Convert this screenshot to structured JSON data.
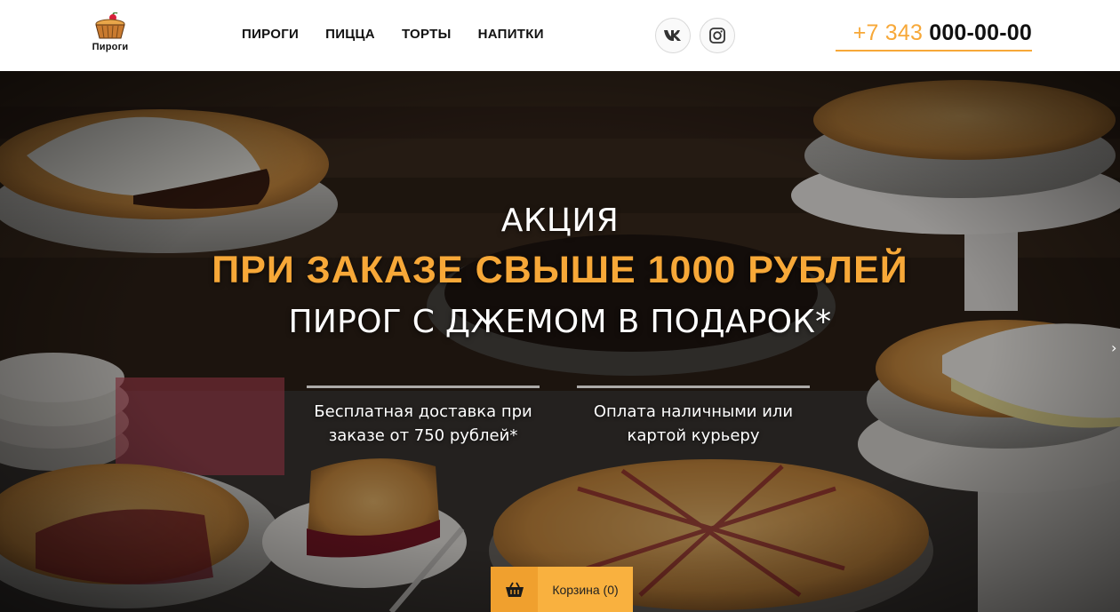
{
  "header": {
    "logo_text": "Пироги",
    "nav": [
      {
        "label": "ПИРОГИ"
      },
      {
        "label": "ПИЦЦА"
      },
      {
        "label": "ТОРТЫ"
      },
      {
        "label": "НАПИТКИ"
      }
    ],
    "social": [
      {
        "icon": "vk-icon"
      },
      {
        "icon": "instagram-icon"
      }
    ],
    "phone_code": "+7 343",
    "phone_number": "000-00-00"
  },
  "hero": {
    "title": "АКЦИЯ",
    "highlight": "ПРИ ЗАКАЗЕ СВЫШЕ 1000 РУБЛЕЙ",
    "subtitle": "ПИРОГ С ДЖЕМОМ В ПОДАРОК*",
    "features": [
      {
        "line1": "Бесплатная доставка при",
        "line2": "заказе от 750 рублей*"
      },
      {
        "line1": "Оплата наличными или",
        "line2": "картой курьеру"
      }
    ],
    "next_arrow": "›"
  },
  "cart": {
    "label": "Корзина (0)",
    "icon": "basket-icon"
  },
  "colors": {
    "accent": "#f7a838",
    "header_bg": "#ffffff",
    "text_dark": "#111111",
    "cart_bg": "#f9b13f"
  }
}
